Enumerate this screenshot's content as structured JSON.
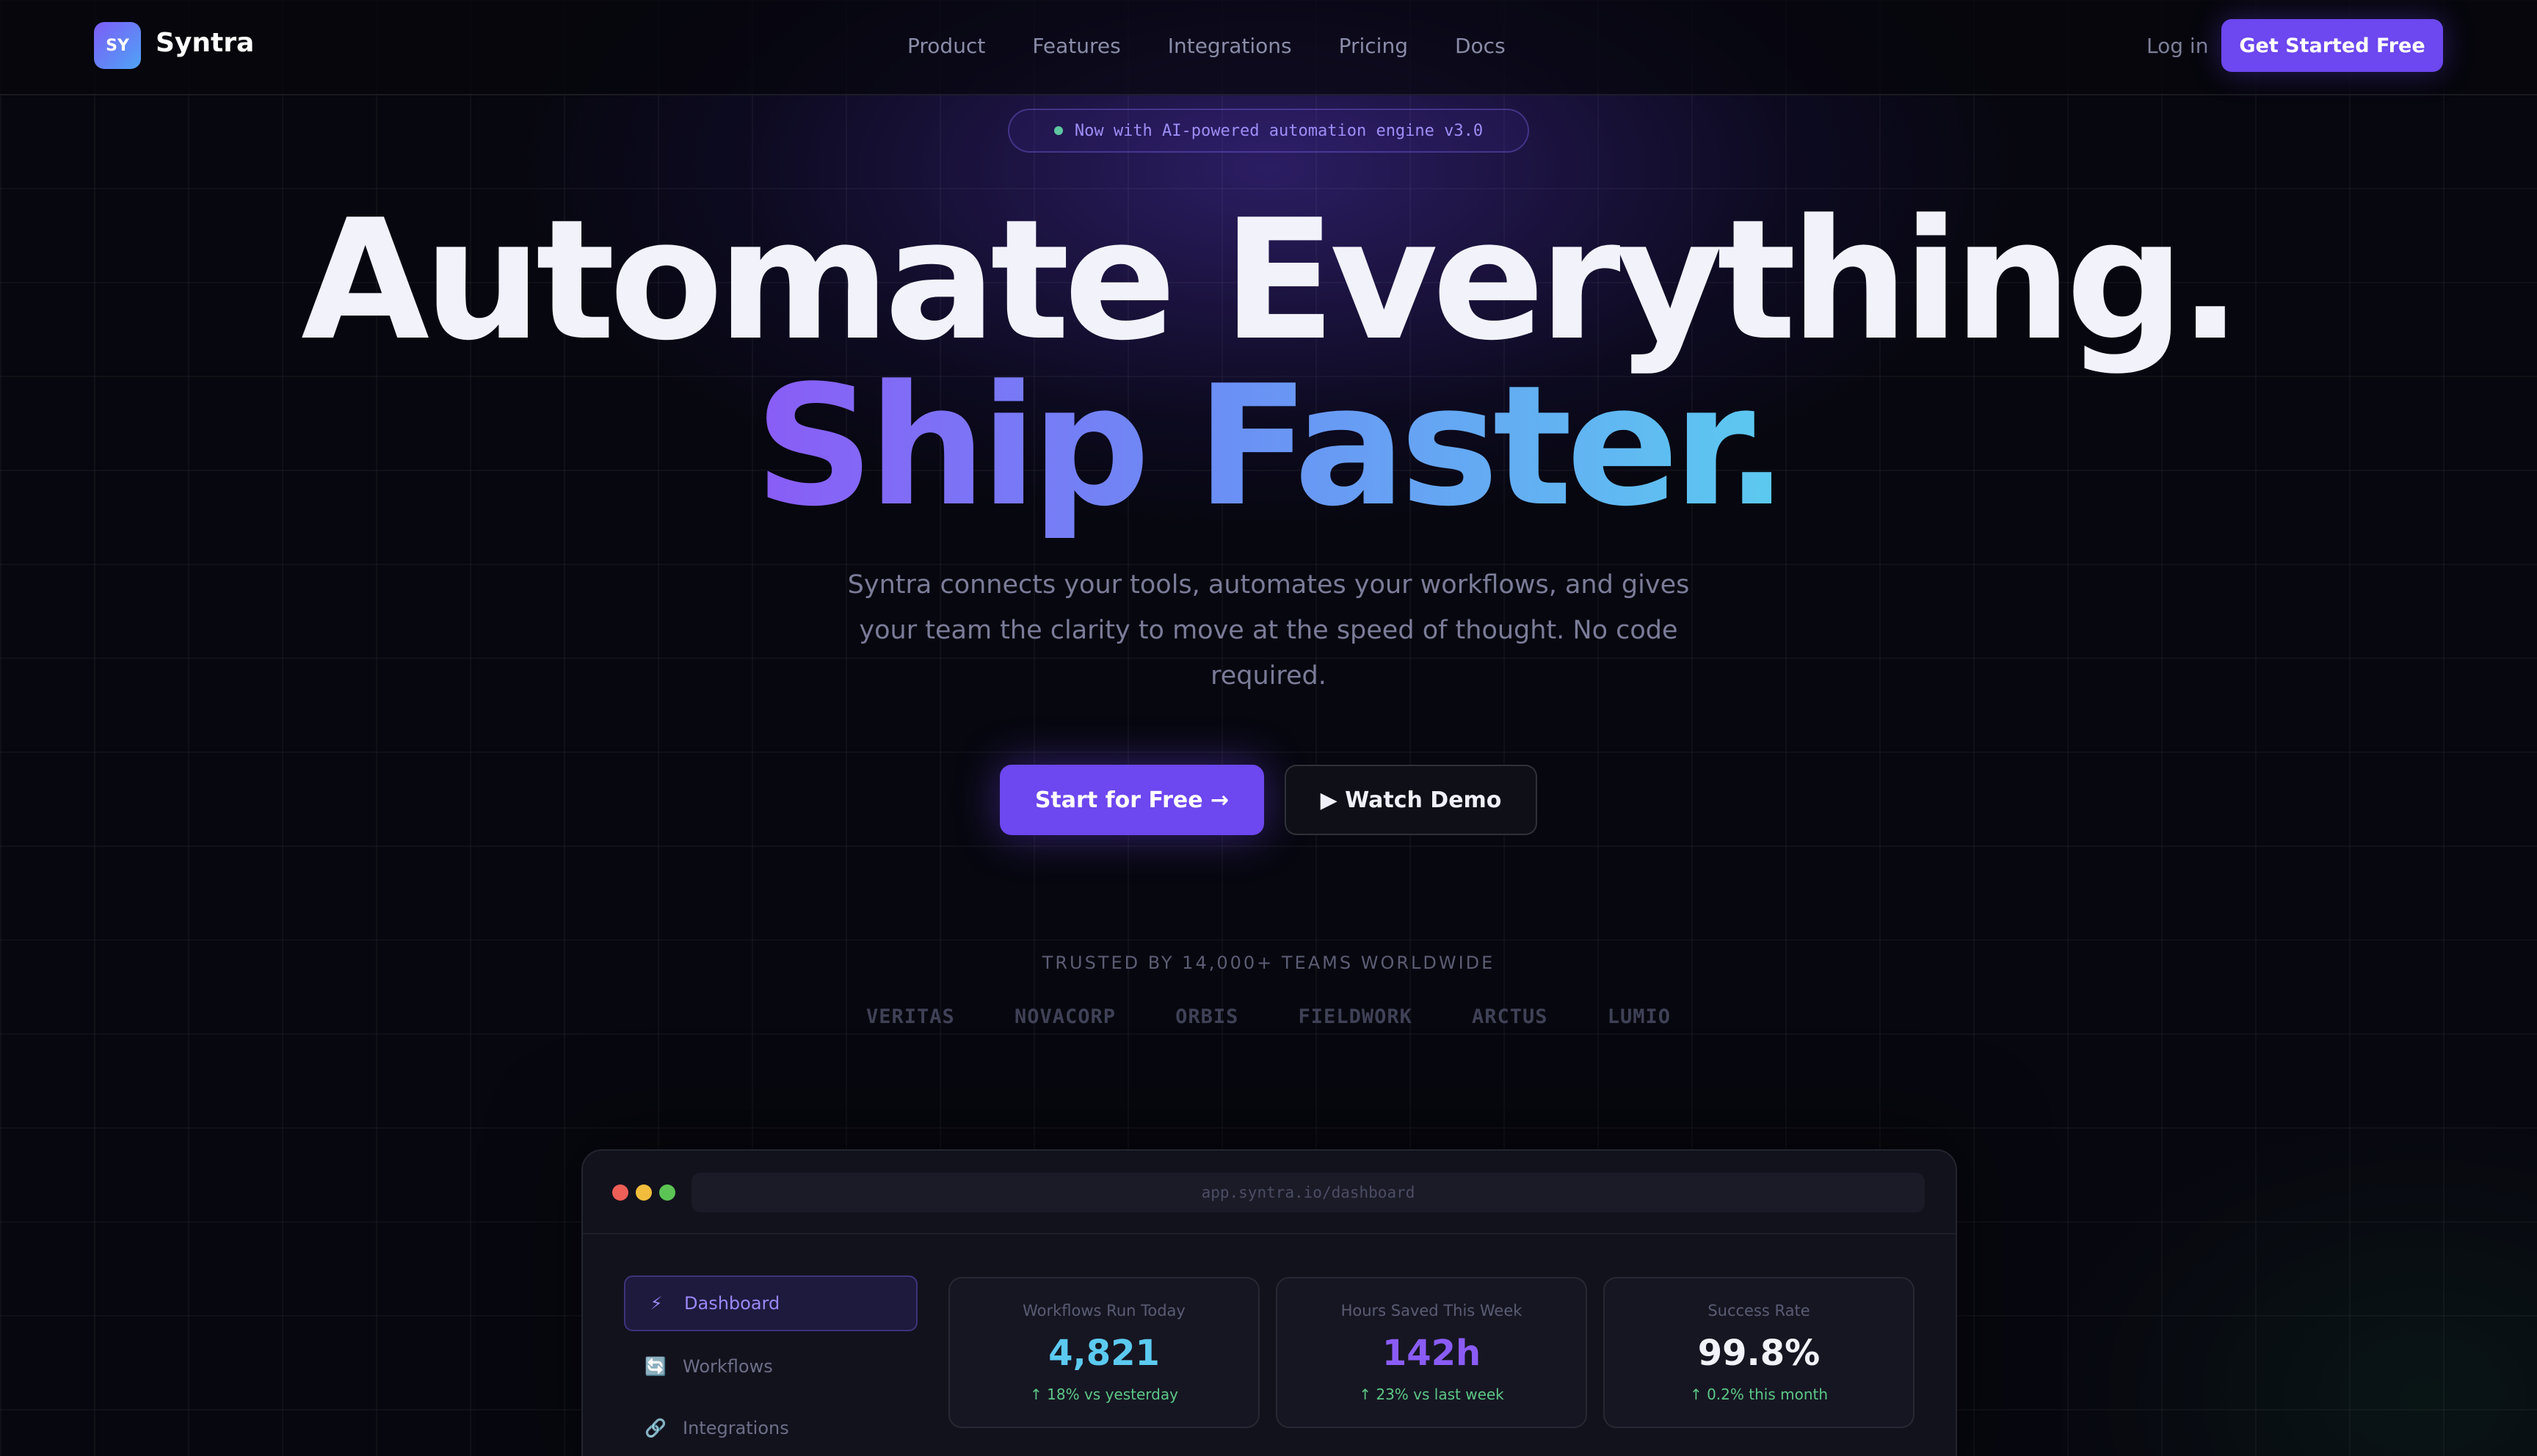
{
  "nav": {
    "logo_mark": "SY",
    "brand": "Syntra",
    "links": [
      "Product",
      "Features",
      "Integrations",
      "Pricing",
      "Docs"
    ],
    "login": "Log in",
    "cta": "Get Started Free"
  },
  "hero": {
    "badge": "Now with AI-powered automation engine v3.0",
    "headline_line1": "Automate Everything.",
    "headline_line2": "Ship Faster.",
    "subtext": "Syntra connects your tools, automates your workflows, and gives your team the clarity to move at the speed of thought. No code required.",
    "primary_button": "Start for Free →",
    "secondary_button": "▶ Watch Demo"
  },
  "trusted": {
    "label": "TRUSTED BY 14,000+ TEAMS WORLDWIDE",
    "brands": [
      "VERITAS",
      "NOVACORP",
      "ORBIS",
      "FIELDWORK",
      "ARCTUS",
      "LUMIO"
    ]
  },
  "preview": {
    "url": "app.syntra.io/dashboard",
    "sidebar": [
      {
        "label": "Dashboard",
        "icon": "lightning-icon",
        "glyph": "⚡"
      },
      {
        "label": "Workflows",
        "icon": "refresh-icon",
        "glyph": "🔄"
      },
      {
        "label": "Integrations",
        "icon": "link-icon",
        "glyph": "🔗"
      }
    ],
    "stats": [
      {
        "label": "Workflows Run Today",
        "value": "4,821",
        "change": "↑ 18% vs yesterday",
        "color": "#5ccaf0"
      },
      {
        "label": "Hours Saved This Week",
        "value": "142h",
        "change": "↑ 23% vs last week",
        "color": "#8a5cf6"
      },
      {
        "label": "Success Rate",
        "value": "99.8%",
        "change": "↑ 0.2% this month",
        "color": "#f2f2fb"
      }
    ]
  },
  "colors": {
    "accent": "#6d47ef",
    "background": "#07070f",
    "positive": "#5dc787"
  }
}
